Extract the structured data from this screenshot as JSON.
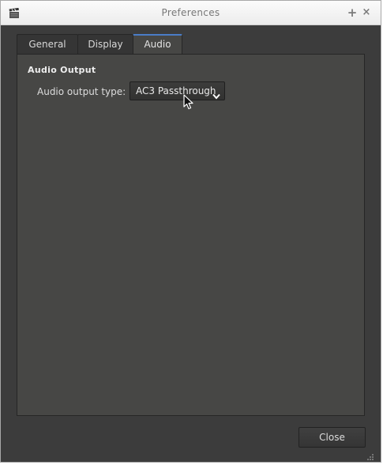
{
  "window": {
    "title": "Preferences",
    "maximize_glyph": "+",
    "close_glyph": "×"
  },
  "tabs": [
    {
      "label": "General",
      "selected": false
    },
    {
      "label": "Display",
      "selected": false
    },
    {
      "label": "Audio",
      "selected": true
    }
  ],
  "audio": {
    "section_title": "Audio Output",
    "output_type_label": "Audio output type:",
    "output_type_value": "AC3 Passthrough"
  },
  "footer": {
    "close_label": "Close"
  },
  "colors": {
    "active_tab_accent": "#4a7cc7",
    "panel_bg": "#474745",
    "window_bg": "#3c3c3c"
  },
  "icons": [
    "clapperboard-icon",
    "maximize-icon",
    "close-icon",
    "chevron-down-icon",
    "mouse-pointer-icon",
    "resize-grip-icon"
  ]
}
